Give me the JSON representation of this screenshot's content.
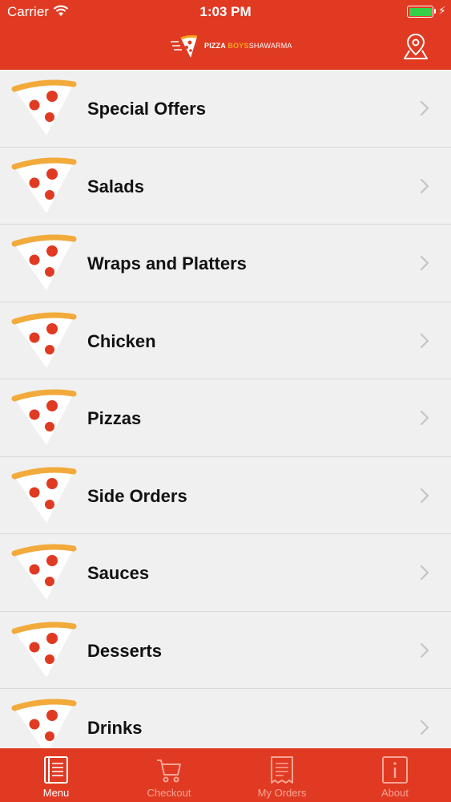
{
  "status_bar": {
    "carrier": "Carrier",
    "time": "1:03 PM",
    "battery_color": "#35d049"
  },
  "header": {
    "logo_part1": "PIZZA",
    "logo_part2": "BOYS",
    "logo_part3": "SHAWARMA",
    "location_icon": "map-pin-icon",
    "bg_color": "#e03a22"
  },
  "menu": {
    "items": [
      {
        "label": "Special Offers"
      },
      {
        "label": "Salads"
      },
      {
        "label": "Wraps and Platters"
      },
      {
        "label": "Chicken"
      },
      {
        "label": "Pizzas"
      },
      {
        "label": "Side Orders"
      },
      {
        "label": "Sauces"
      },
      {
        "label": "Desserts"
      },
      {
        "label": "Drinks"
      }
    ],
    "item_icon": "pizza-slice-icon",
    "chevron_icon": "chevron-right-icon"
  },
  "tabs": [
    {
      "label": "Menu",
      "icon": "menu-book-icon",
      "active": true
    },
    {
      "label": "Checkout",
      "icon": "cart-icon",
      "active": false
    },
    {
      "label": "My Orders",
      "icon": "receipt-icon",
      "active": false
    },
    {
      "label": "About",
      "icon": "info-icon",
      "active": false
    }
  ]
}
